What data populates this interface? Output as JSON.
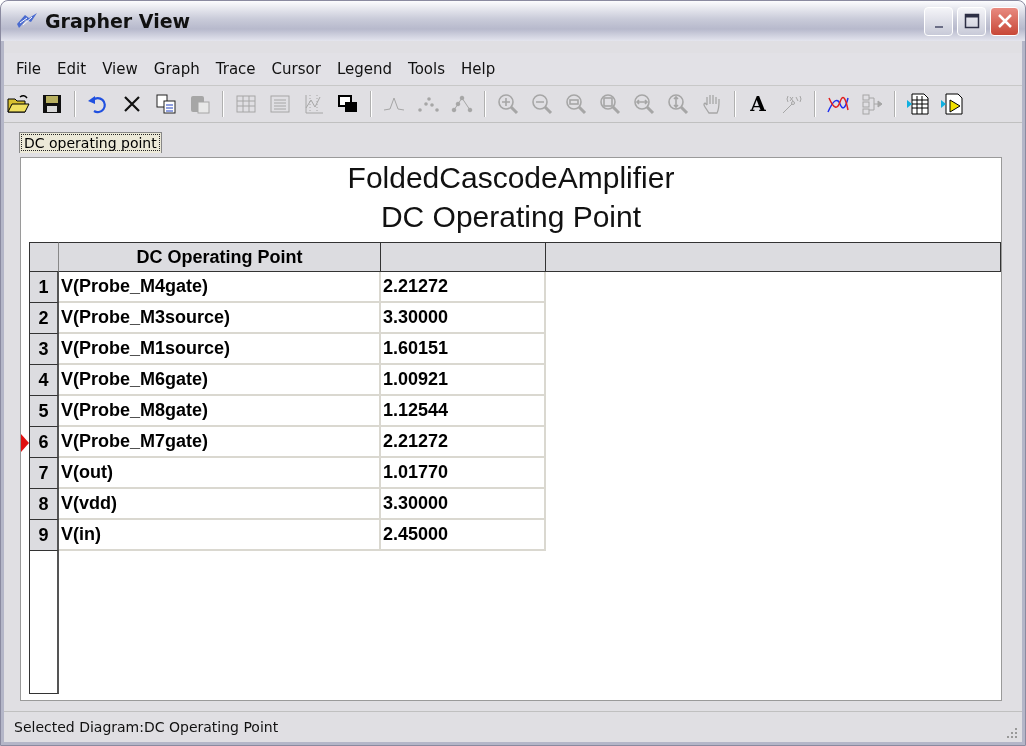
{
  "window": {
    "title": "Grapher View"
  },
  "menu": [
    "File",
    "Edit",
    "View",
    "Graph",
    "Trace",
    "Cursor",
    "Legend",
    "Tools",
    "Help"
  ],
  "toolbar": [
    {
      "kind": "open",
      "disabled": false
    },
    {
      "kind": "save",
      "disabled": false
    },
    {
      "kind": "separator"
    },
    {
      "kind": "undo",
      "disabled": false
    },
    {
      "kind": "delete",
      "disabled": false
    },
    {
      "kind": "copy",
      "disabled": false
    },
    {
      "kind": "paste",
      "disabled": true
    },
    {
      "kind": "separator"
    },
    {
      "kind": "grid",
      "disabled": true
    },
    {
      "kind": "list",
      "disabled": true
    },
    {
      "kind": "chart",
      "disabled": true
    },
    {
      "kind": "overlay",
      "disabled": false
    },
    {
      "kind": "separator"
    },
    {
      "kind": "peak",
      "disabled": true
    },
    {
      "kind": "dots",
      "disabled": true
    },
    {
      "kind": "dotline",
      "disabled": true
    },
    {
      "kind": "separator"
    },
    {
      "kind": "zoom-in",
      "disabled": true
    },
    {
      "kind": "zoom-out",
      "disabled": true
    },
    {
      "kind": "zoom-fit",
      "disabled": true
    },
    {
      "kind": "zoom-box",
      "disabled": true
    },
    {
      "kind": "zoom-x",
      "disabled": true
    },
    {
      "kind": "zoom-y",
      "disabled": true
    },
    {
      "kind": "pan",
      "disabled": true
    },
    {
      "kind": "separator"
    },
    {
      "kind": "text",
      "label": "A",
      "disabled": false
    },
    {
      "kind": "xy",
      "disabled": true
    },
    {
      "kind": "separator"
    },
    {
      "kind": "traces",
      "disabled": false
    },
    {
      "kind": "export",
      "disabled": true
    },
    {
      "kind": "separator"
    },
    {
      "kind": "table",
      "disabled": false
    },
    {
      "kind": "table-run",
      "disabled": false
    }
  ],
  "tabs": [
    {
      "label": "DC operating point",
      "selected": true
    }
  ],
  "diagram": {
    "title": "FoldedCascodeAmplifier",
    "subtitle": "DC Operating Point"
  },
  "table": {
    "columns": [
      "DC Operating Point"
    ],
    "rows": [
      {
        "index": "1",
        "name": "V(Probe_M4gate)",
        "value": "2.21272",
        "current": false
      },
      {
        "index": "2",
        "name": "V(Probe_M3source)",
        "value": "3.30000",
        "current": false
      },
      {
        "index": "3",
        "name": "V(Probe_M1source)",
        "value": "1.60151",
        "current": false
      },
      {
        "index": "4",
        "name": "V(Probe_M6gate)",
        "value": "1.00921",
        "current": false
      },
      {
        "index": "5",
        "name": "V(Probe_M8gate)",
        "value": "1.12544",
        "current": false
      },
      {
        "index": "6",
        "name": "V(Probe_M7gate)",
        "value": "2.21272",
        "current": true
      },
      {
        "index": "7",
        "name": "V(out)",
        "value": "1.01770",
        "current": false
      },
      {
        "index": "8",
        "name": "V(vdd)",
        "value": "3.30000",
        "current": false
      },
      {
        "index": "9",
        "name": "V(in)",
        "value": "2.45000",
        "current": false
      }
    ]
  },
  "status_bar": "Selected Diagram:DC Operating Point"
}
